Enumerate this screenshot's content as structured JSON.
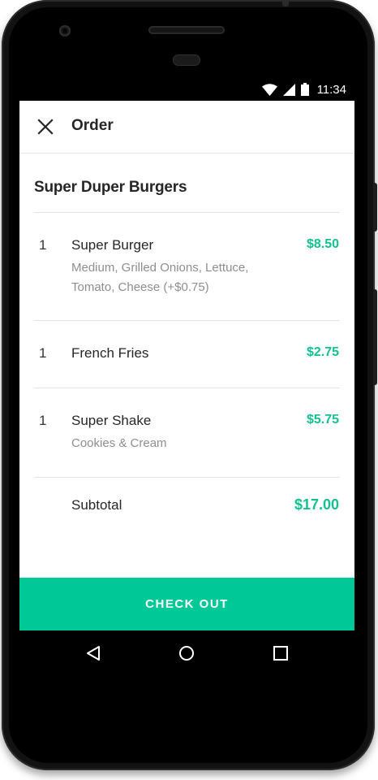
{
  "status_bar": {
    "time": "11:34",
    "icons": [
      "wifi-icon",
      "signal-icon",
      "battery-icon"
    ]
  },
  "app_bar": {
    "title": "Order",
    "close_icon": "close-icon"
  },
  "restaurant": {
    "name": "Super Duper Burgers"
  },
  "items": [
    {
      "qty": "1",
      "name": "Super Burger",
      "description": "Medium, Grilled Onions, Lettuce, Tomato, Cheese (+$0.75)",
      "price": "$8.50"
    },
    {
      "qty": "1",
      "name": "French Fries",
      "description": "",
      "price": "$2.75"
    },
    {
      "qty": "1",
      "name": "Super Shake",
      "description": "Cookies & Cream",
      "price": "$5.75"
    }
  ],
  "summary": {
    "subtotal_label": "Subtotal",
    "subtotal_value": "$17.00"
  },
  "checkout": {
    "label": "CHECK OUT"
  },
  "nav_bar": {
    "icons": [
      "back-icon",
      "home-icon",
      "recents-icon"
    ]
  },
  "colors": {
    "accent": "#00c896",
    "price": "#10c191",
    "text": "#262626",
    "muted": "#8e8e8e"
  }
}
